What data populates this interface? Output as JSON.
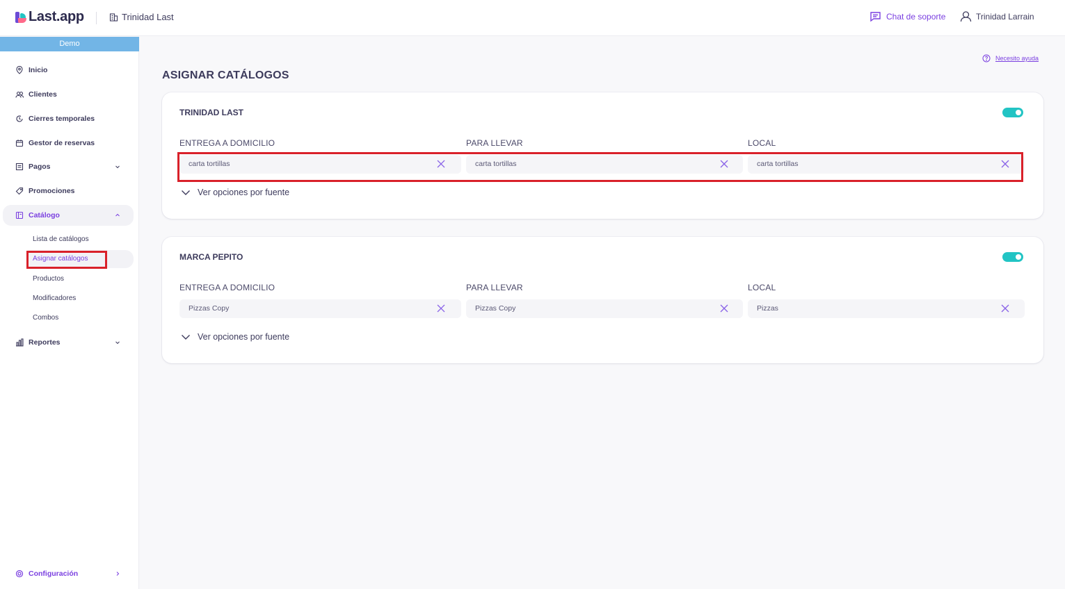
{
  "header": {
    "logo_text": "Last.app",
    "location": "Trinidad Last",
    "support_label": "Chat de soporte",
    "user_name": "Trinidad Larrain"
  },
  "sidebar": {
    "demo_label": "Demo",
    "items": [
      {
        "label": "Inicio",
        "icon": "location-pin-icon"
      },
      {
        "label": "Clientes",
        "icon": "users-icon"
      },
      {
        "label": "Cierres temporales",
        "icon": "clock-icon"
      },
      {
        "label": "Gestor de reservas",
        "icon": "calendar-icon"
      },
      {
        "label": "Pagos",
        "icon": "receipt-icon"
      },
      {
        "label": "Promociones",
        "icon": "tag-icon"
      },
      {
        "label": "Catálogo",
        "icon": "catalog-icon"
      },
      {
        "label": "Reportes",
        "icon": "bar-chart-icon"
      }
    ],
    "catalog_sub": [
      {
        "label": "Lista de catálogos"
      },
      {
        "label": "Asignar catálogos"
      },
      {
        "label": "Productos"
      },
      {
        "label": "Modificadores"
      },
      {
        "label": "Combos"
      }
    ],
    "config_label": "Configuración"
  },
  "main": {
    "help_label": "Necesito ayuda",
    "title": "ASIGNAR CATÁLOGOS",
    "cards": [
      {
        "title": "TRINIDAD LAST",
        "enabled": true,
        "columns": [
          {
            "label": "ENTREGA A DOMICILIO",
            "value": "carta tortillas"
          },
          {
            "label": "PARA LLEVAR",
            "value": "carta tortillas"
          },
          {
            "label": "LOCAL",
            "value": "carta tortillas"
          }
        ],
        "expand_label": "Ver opciones por fuente"
      },
      {
        "title": "MARCA PEPITO",
        "enabled": true,
        "columns": [
          {
            "label": "ENTREGA A DOMICILIO",
            "value": "Pizzas Copy"
          },
          {
            "label": "PARA LLEVAR",
            "value": "Pizzas Copy"
          },
          {
            "label": "LOCAL",
            "value": "Pizzas"
          }
        ],
        "expand_label": "Ver opciones por fuente"
      }
    ]
  },
  "colors": {
    "accent": "#7a3fe0",
    "toggle_on": "#22c4c4",
    "demo_bar": "#72b5e6",
    "highlight": "#d9212a"
  }
}
